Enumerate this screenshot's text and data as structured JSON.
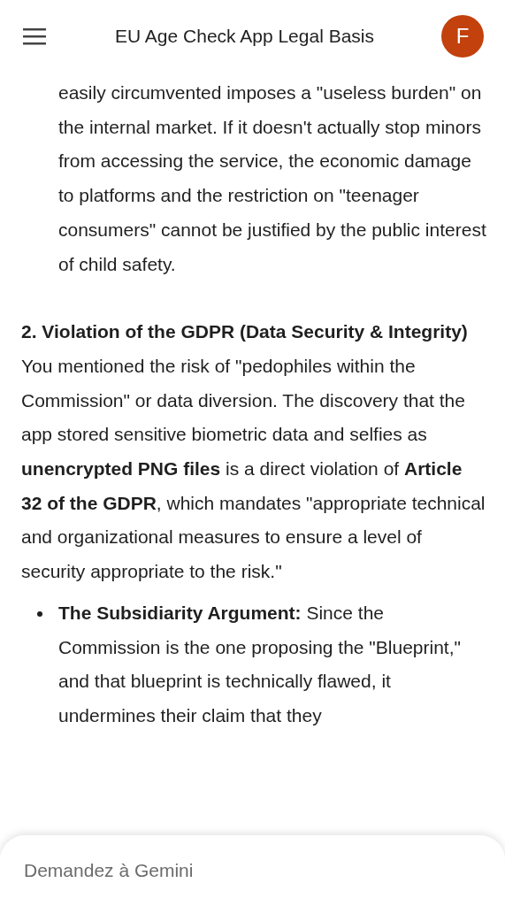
{
  "header": {
    "title": "EU Age Check App Legal Basis",
    "avatar": "F"
  },
  "blocks": [
    {
      "kind": "indented",
      "text": "easily circumvented imposes a \"useless burden\" on the internal market. If it doesn't actually stop minors from accessing the service, the economic damage to platforms and the restriction on \"teenager consumers\" cannot be justified by the public interest of child safety."
    },
    {
      "kind": "heading",
      "text": "2. Violation of the GDPR (Data Security & Integrity)"
    },
    {
      "kind": "paragraph",
      "text": "You mentioned the risk of \"pedophiles within the Commission\" or data diversion. The discovery that the app stored sensitive biometric data and selfies as **unencrypted PNG files** is a direct violation of **Article 32 of the GDPR**, which mandates \"appropriate technical and organizational measures to ensure a level of security appropriate to the risk.\""
    },
    {
      "kind": "bullet",
      "text": "**The Subsidiarity Argument:** Since the Commission is the one proposing the \"Blueprint,\" and that blueprint is technically flawed, it undermines their claim that they"
    }
  ],
  "composer": {
    "placeholder": "Demandez à Gemini"
  }
}
